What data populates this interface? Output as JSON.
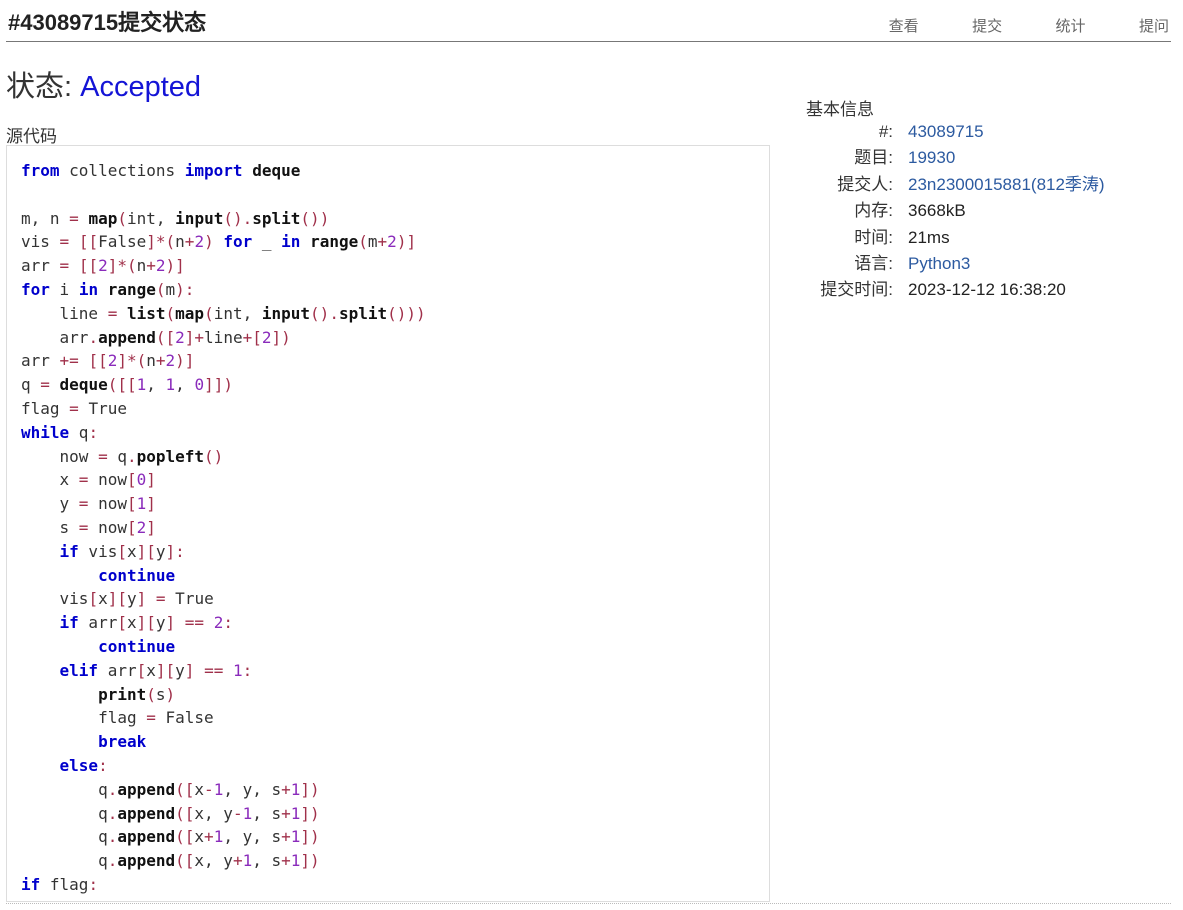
{
  "header": {
    "title": "#43089715提交状态",
    "nav": [
      "查看",
      "提交",
      "统计",
      "提问"
    ]
  },
  "status": {
    "label": "状态: ",
    "value": "Accepted"
  },
  "source": {
    "label": "源代码",
    "language": "python",
    "code": "from collections import deque\n\nm, n = map(int, input().split())\nvis = [[False]*(n+2) for _ in range(m+2)]\narr = [[2]*(n+2)]\nfor i in range(m):\n    line = list(map(int, input().split()))\n    arr.append([2]+line+[2])\narr += [[2]*(n+2)]\nq = deque([[1, 1, 0]])\nflag = True\nwhile q:\n    now = q.popleft()\n    x = now[0]\n    y = now[1]\n    s = now[2]\n    if vis[x][y]:\n        continue\n    vis[x][y] = True\n    if arr[x][y] == 2:\n        continue\n    elif arr[x][y] == 1:\n        print(s)\n        flag = False\n        break\n    else:\n        q.append([x-1, y, s+1])\n        q.append([x, y-1, s+1])\n        q.append([x+1, y, s+1])\n        q.append([x, y+1, s+1])\nif flag:\n    print('NO')"
  },
  "info": {
    "title": "基本信息",
    "rows": [
      {
        "key": "#:",
        "value": "43089715",
        "link": true
      },
      {
        "key": "题目:",
        "value": "19930",
        "link": true
      },
      {
        "key": "提交人:",
        "value": "23n2300015881(812季涛)",
        "link": true
      },
      {
        "key": "内存:",
        "value": "3668kB",
        "link": false
      },
      {
        "key": "时间:",
        "value": "21ms",
        "link": false
      },
      {
        "key": "语言:",
        "value": "Python3",
        "link": true
      },
      {
        "key": "提交时间:",
        "value": "2023-12-12 16:38:20",
        "link": false
      }
    ]
  }
}
